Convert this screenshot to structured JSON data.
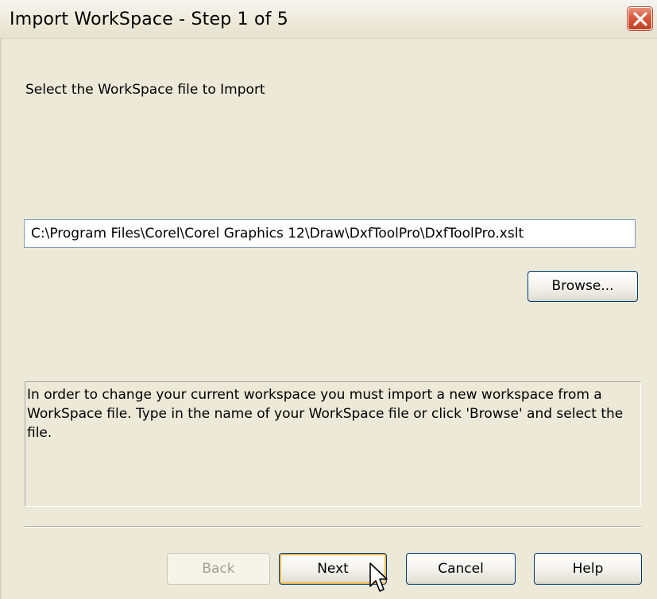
{
  "window": {
    "title": "Import WorkSpace - Step 1 of 5"
  },
  "main": {
    "instruction": "Select the WorkSpace file to Import",
    "file_path": "C:\\Program Files\\Corel\\Corel Graphics 12\\Draw\\DxfToolPro\\DxfToolPro.xslt",
    "browse_label": "Browse...",
    "description": "In order to change your current workspace you must import a new workspace from a WorkSpace file. Type in the name of your WorkSpace file or click 'Browse' and select the file."
  },
  "footer": {
    "back_label": "Back",
    "next_label": "Next",
    "cancel_label": "Cancel",
    "help_label": "Help"
  },
  "icons": {
    "close": "close-icon",
    "cursor": "mouse-pointer-icon"
  },
  "colors": {
    "close_button": "#d55a3c",
    "button_border": "#003c74",
    "default_button_highlight": "#f0b850",
    "input_border": "#7f9db9"
  }
}
